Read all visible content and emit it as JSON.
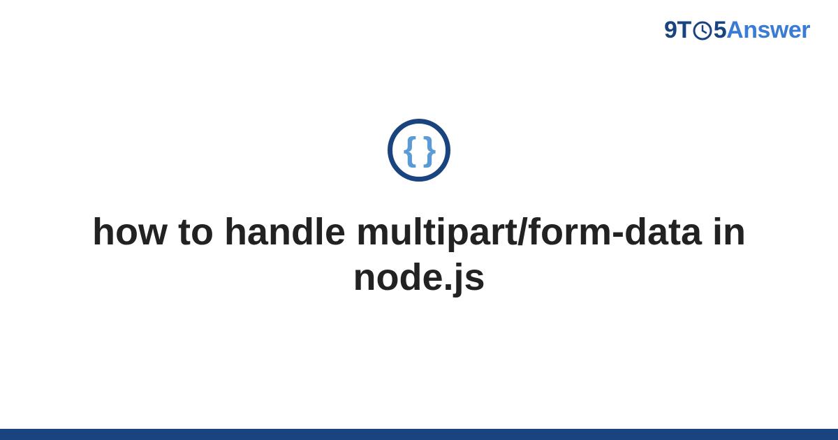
{
  "logo": {
    "nine": "9",
    "t": "T",
    "five": "5",
    "answer": "Answer"
  },
  "icon": {
    "braces": "{ }"
  },
  "title": "how to handle multipart/form-data in node.js",
  "colors": {
    "brand_dark": "#1a4480",
    "brand_light": "#3a7bd5",
    "icon_brace": "#5a9bd5"
  }
}
